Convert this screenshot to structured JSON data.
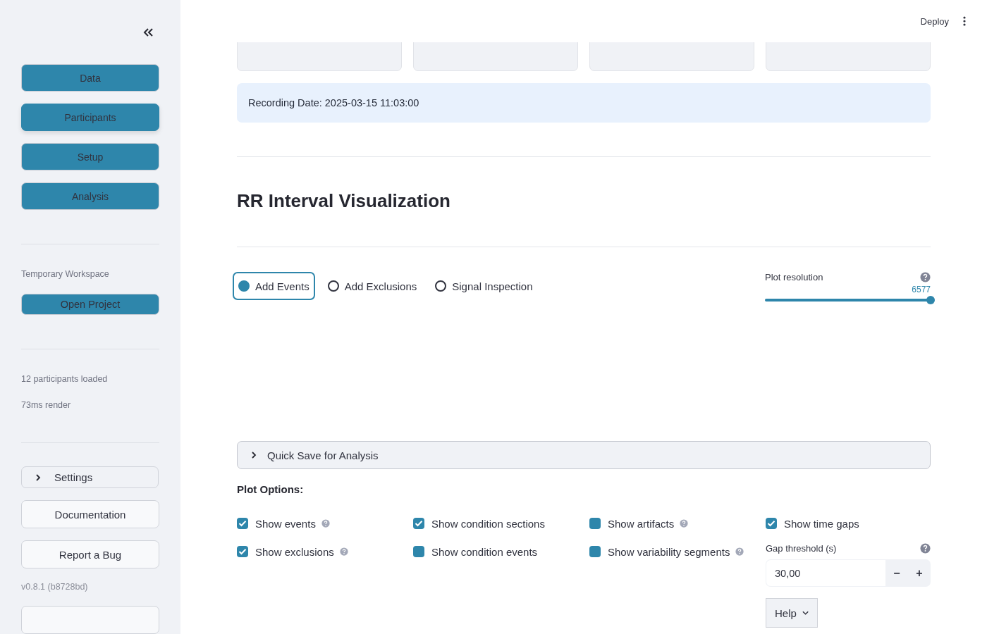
{
  "sidebar": {
    "nav_buttons": [
      {
        "label": "Data",
        "selected": false
      },
      {
        "label": "Participants",
        "selected": true
      },
      {
        "label": "Setup",
        "selected": false
      },
      {
        "label": "Analysis",
        "selected": false
      }
    ],
    "workspace_label": "Temporary Workspace",
    "open_project": "Open Project",
    "status_lines": [
      "12 participants loaded",
      "73ms render"
    ],
    "settings": {
      "label": "Settings",
      "expanded": false
    },
    "links": [
      "Documentation",
      "Report a Bug"
    ],
    "version": "v0.8.1 (b8728bd)"
  },
  "header": {
    "deploy": "Deploy"
  },
  "info": "Recording Date: 2025-03-15 11:03:00",
  "heading": "RR Interval Visualization",
  "modes": [
    {
      "label": "Add Events",
      "selected": true
    },
    {
      "label": "Add Exclusions",
      "selected": false
    },
    {
      "label": "Signal Inspection",
      "selected": false
    }
  ],
  "plot_resolution": {
    "label": "Plot resolution",
    "value": "6577",
    "level": 1.0
  },
  "quick_save": {
    "label": "Quick Save for Analysis",
    "expanded": false
  },
  "plot_options": {
    "title": "Plot Options:",
    "columns": [
      [
        {
          "label": "Show events",
          "checked": true,
          "help": true
        },
        {
          "label": "Show exclusions",
          "checked": true,
          "help": true
        }
      ],
      [
        {
          "label": "Show condition sections",
          "checked": true,
          "help": false
        },
        {
          "label": "Show condition events",
          "checked": false,
          "help": false
        }
      ],
      [
        {
          "label": "Show artifacts",
          "checked": false,
          "help": true
        },
        {
          "label": "Show variability segments",
          "checked": false,
          "help": true
        }
      ],
      [
        {
          "label": "Show time gaps",
          "checked": true,
          "help": false
        }
      ]
    ],
    "gap_threshold": {
      "label": "Gap threshold (s)",
      "value": "30,00",
      "minus": "−",
      "plus": "+"
    },
    "help_button": "Help"
  }
}
